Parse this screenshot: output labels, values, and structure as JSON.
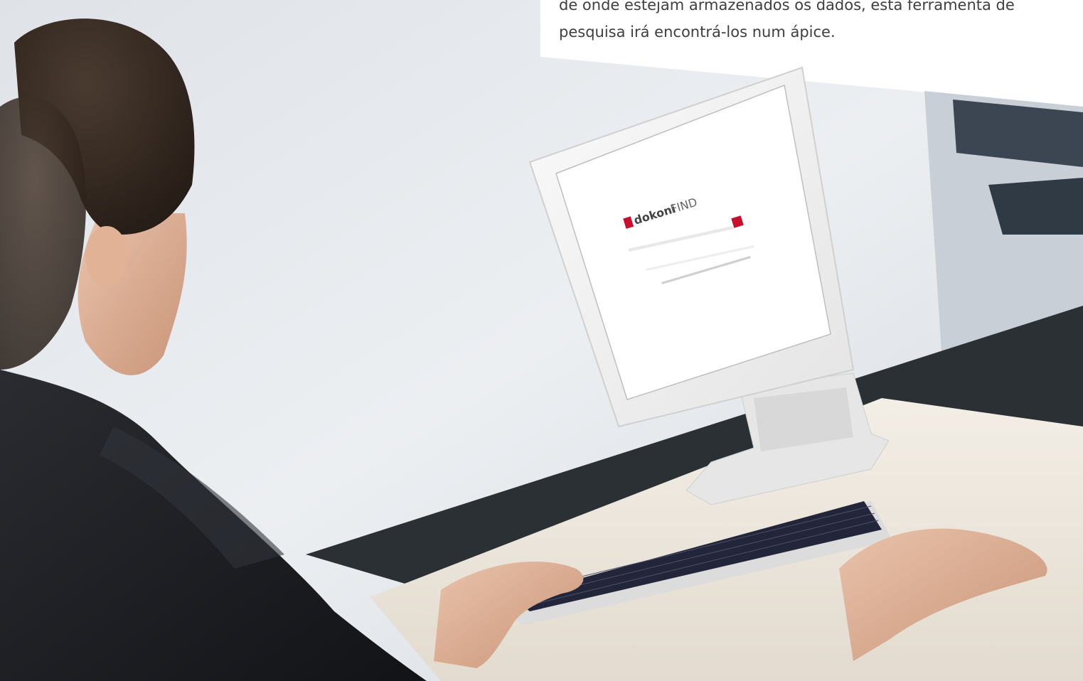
{
  "caption": {
    "lines": [
      "de onde estejam armazenados os dados, esta ferramenta de",
      "pesquisa irá encontrá-los num ápice."
    ]
  },
  "screen": {
    "logo_brand": "dokoni",
    "logo_product": "FIND"
  },
  "colors": {
    "accent": "#c8102e",
    "wall": "#e9ecef",
    "shirt": "#1b1d22",
    "desk": "#efe9df"
  }
}
